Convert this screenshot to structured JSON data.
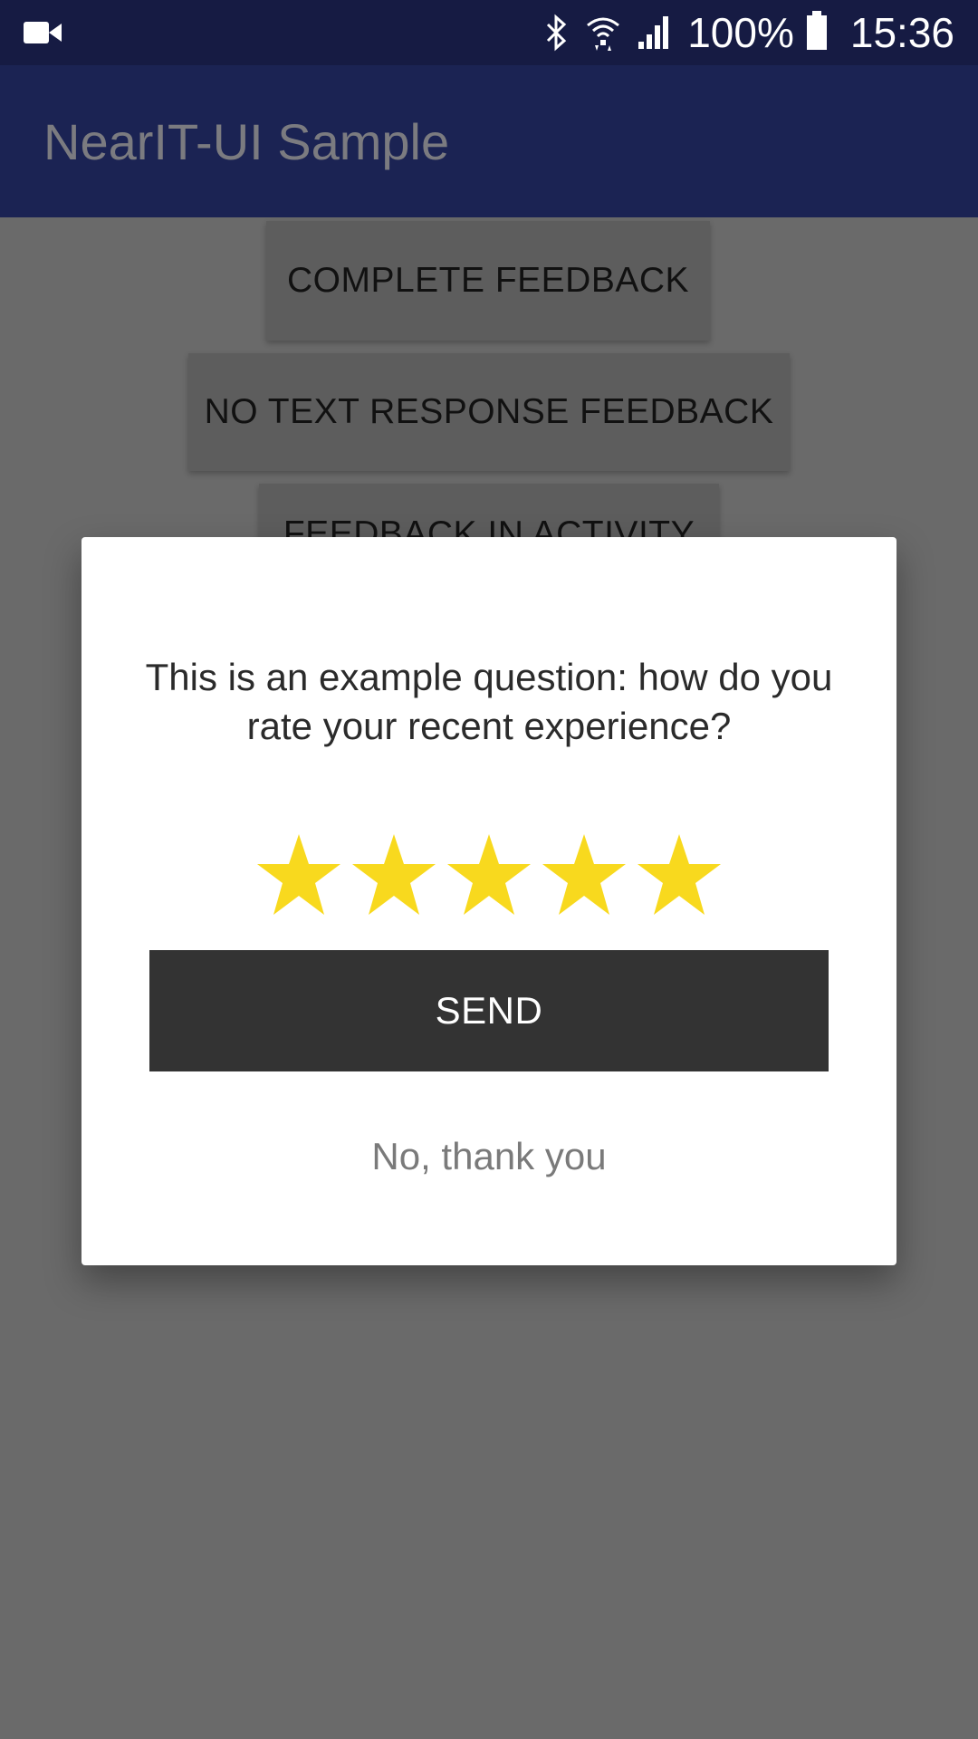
{
  "status_bar": {
    "left_icon": "video-camera-icon",
    "icons": [
      "bluetooth-icon",
      "wifi-icon",
      "cell-signal-icon"
    ],
    "battery_percent": "100%",
    "battery_icon": "battery-icon",
    "time": "15:36"
  },
  "app_bar": {
    "title": "NearIT-UI Sample",
    "background_color": "#1b2353"
  },
  "background_buttons": [
    {
      "label": "COMPLETE FEEDBACK"
    },
    {
      "label": "NO TEXT RESPONSE FEEDBACK"
    },
    {
      "label": "FEEDBACK IN ACTIVITY"
    }
  ],
  "dialog": {
    "question": "This is an example question: how do you rate your recent experience?",
    "rating": {
      "value": 5,
      "max": 5,
      "star_color": "#f8d91e"
    },
    "send_label": "SEND",
    "decline_label": "No, thank you"
  }
}
